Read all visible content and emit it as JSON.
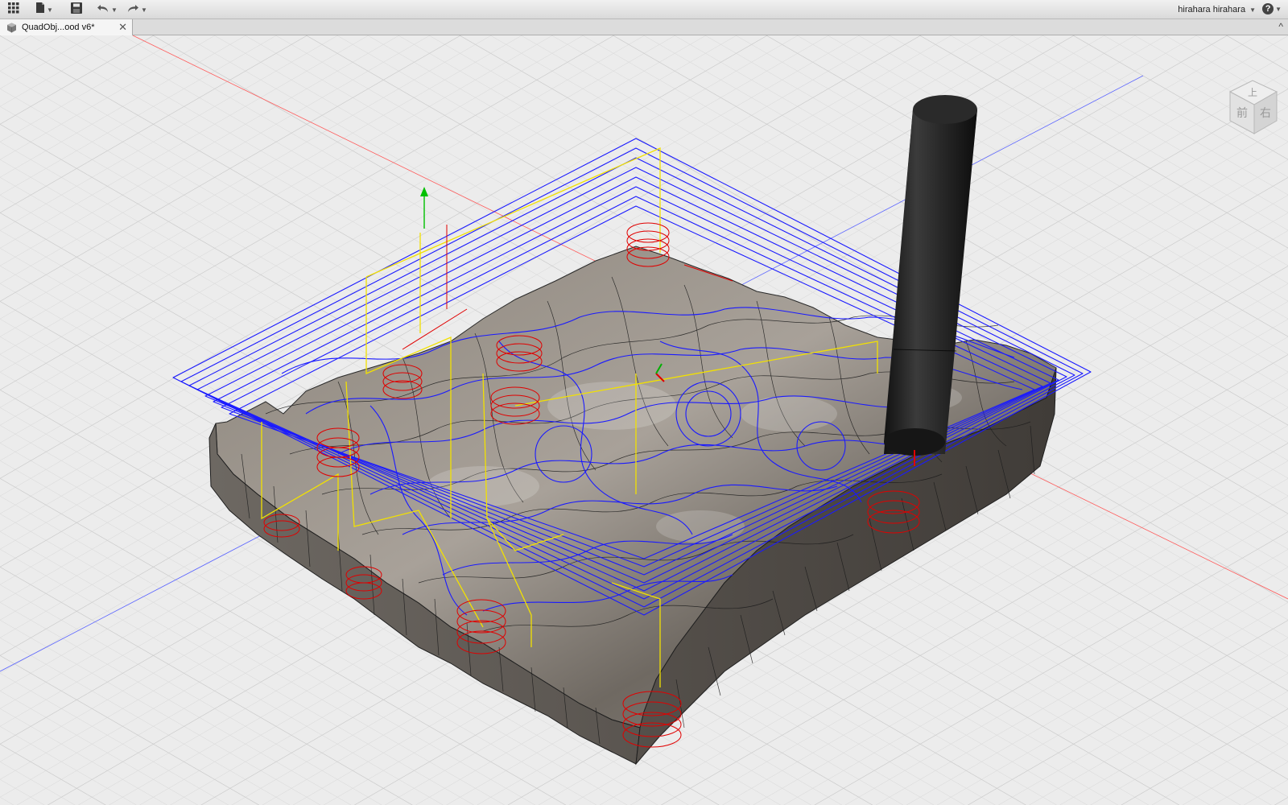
{
  "toolbar": {
    "apps_icon": "grid-icon",
    "file_icon": "file-icon",
    "save_icon": "save-icon",
    "undo_icon": "undo-icon",
    "redo_icon": "redo-icon",
    "user_name": "hirahara hirahara",
    "help_label": "?"
  },
  "tabs": [
    {
      "label": "QuadObj...ood v6*",
      "icon": "part-icon",
      "active": true
    }
  ],
  "viewcube": {
    "top_label": "上",
    "front_label": "前",
    "right_label": "右"
  },
  "colors": {
    "toolpath_cutting": "#1a1aff",
    "toolpath_rapid": "#f2e100",
    "toolpath_plunge": "#e00000",
    "model_surface": "#7a746d",
    "tool_body": "#1c1c1c",
    "axis_x": "#ff4040",
    "axis_y": "#4a55ff",
    "grid": "#d4d4d4"
  }
}
